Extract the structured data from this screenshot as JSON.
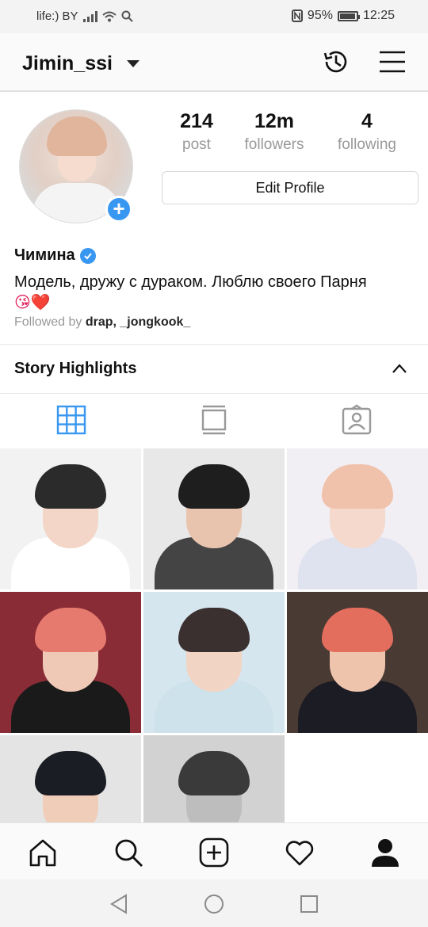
{
  "status_bar": {
    "carrier": "life:) BY",
    "battery": "95%",
    "battery_level": 0.95,
    "time": "12:25"
  },
  "header": {
    "username": "Jimin_ssi"
  },
  "profile": {
    "stats": [
      {
        "value": "214",
        "label": "post"
      },
      {
        "value": "12m",
        "label": "followers"
      },
      {
        "value": "4",
        "label": "following"
      }
    ],
    "edit_button": "Edit Profile",
    "display_name": "Чимина",
    "bio": "Модель, дружу с дураком. Люблю своего Парня",
    "bio_emoji": "😘❤️",
    "followed_by_prefix": "Followed by",
    "followed_by_names": "drap, _jongkook_"
  },
  "highlights": {
    "title": "Story Highlights"
  },
  "tabs": [
    {
      "icon": "grid-icon",
      "active": true
    },
    {
      "icon": "feed-list-icon",
      "active": false
    },
    {
      "icon": "tagged-icon",
      "active": false
    }
  ],
  "grid_posts": [
    {
      "bg": "#f2f2f2",
      "skin": "#f3d6c7",
      "hair": "#2b2b2b",
      "cloth": "#ffffff"
    },
    {
      "bg": "#e8e8e8",
      "skin": "#e8c3ad",
      "hair": "#1e1e1e",
      "cloth": "#444444"
    },
    {
      "bg": "#f1eef4",
      "skin": "#f4d9cc",
      "hair": "#f0c1ab",
      "cloth": "#dfe3f0"
    },
    {
      "bg": "#8a2c36",
      "skin": "#f0c8b6",
      "hair": "#e77a6e",
      "cloth": "#1a1a1a"
    },
    {
      "bg": "#d6e6ee",
      "skin": "#f2d4c4",
      "hair": "#3a3030",
      "cloth": "#cde2ea"
    },
    {
      "bg": "#4a3a34",
      "skin": "#eec4ad",
      "hair": "#e46e5e",
      "cloth": "#1c1c24"
    },
    {
      "bg": "#e4e4e4",
      "skin": "#f0cdb8",
      "hair": "#1b1d24",
      "cloth": "#202020"
    },
    {
      "bg": "#d2d2d2",
      "skin": "#bdbdbd",
      "hair": "#3a3a3a",
      "cloth": "#2a2a2a"
    }
  ],
  "bottom_nav": [
    "home-icon",
    "search-icon",
    "new-post-icon",
    "activity-heart-icon",
    "profile-icon"
  ],
  "system_nav": [
    "back-icon",
    "home-circle-icon",
    "recents-icon"
  ],
  "colors": {
    "accent": "#3897f0",
    "text": "#262626",
    "muted": "#999999"
  }
}
